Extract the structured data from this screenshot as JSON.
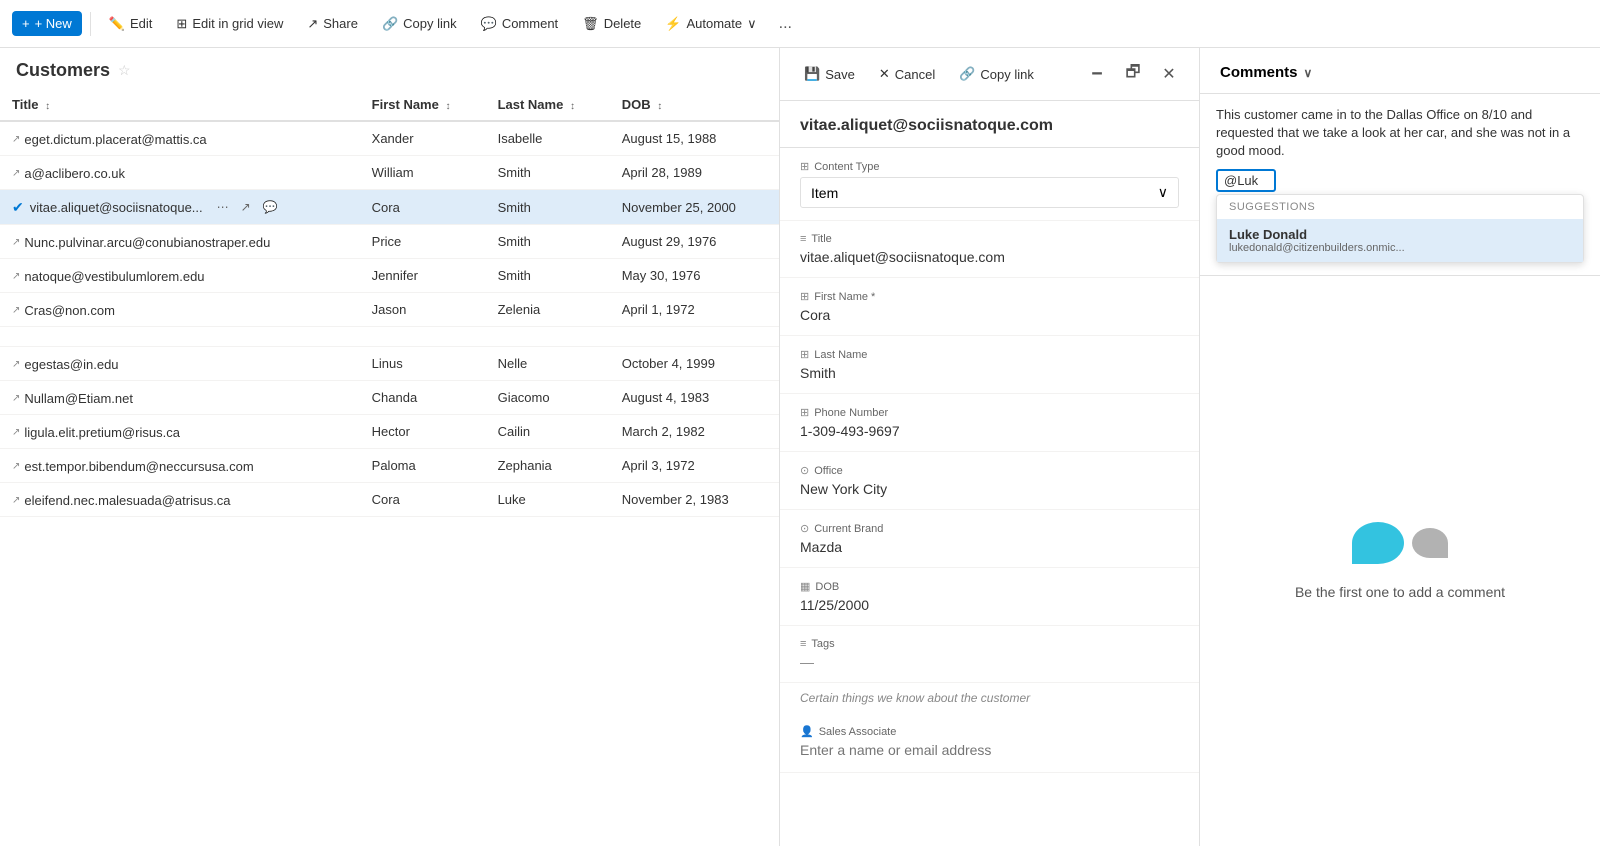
{
  "topbar": {
    "new_label": "+ New",
    "edit_label": "Edit",
    "edit_grid_label": "Edit in grid view",
    "share_label": "Share",
    "copy_link_label": "Copy link",
    "comment_label": "Comment",
    "delete_label": "Delete",
    "automate_label": "Automate",
    "overflow_label": "..."
  },
  "list": {
    "title": "Customers",
    "columns": [
      {
        "label": "Title",
        "sort": "↕"
      },
      {
        "label": "First Name",
        "sort": "↕"
      },
      {
        "label": "Last Name",
        "sort": "↕"
      },
      {
        "label": "DOB",
        "sort": "↕"
      }
    ],
    "rows": [
      {
        "title": "eget.dictum.placerat@mattis.ca",
        "first_name": "Xander",
        "last_name": "Isabelle",
        "dob": "August 15, 1988",
        "selected": false
      },
      {
        "title": "a@aclibero.co.uk",
        "first_name": "William",
        "last_name": "Smith",
        "dob": "April 28, 1989",
        "selected": false
      },
      {
        "title": "vitae.aliquet@sociisnatoque...",
        "first_name": "Cora",
        "last_name": "Smith",
        "dob": "November 25, 2000",
        "selected": true
      },
      {
        "title": "Nunc.pulvinar.arcu@conubianostraper.edu",
        "first_name": "Price",
        "last_name": "Smith",
        "dob": "August 29, 1976",
        "selected": false
      },
      {
        "title": "natoque@vestibulumlorem.edu",
        "first_name": "Jennifer",
        "last_name": "Smith",
        "dob": "May 30, 1976",
        "selected": false
      },
      {
        "title": "Cras@non.com",
        "first_name": "Jason",
        "last_name": "Zelenia",
        "dob": "April 1, 1972",
        "selected": false
      },
      {
        "title": "",
        "first_name": "",
        "last_name": "",
        "dob": "",
        "selected": false
      },
      {
        "title": "egestas@in.edu",
        "first_name": "Linus",
        "last_name": "Nelle",
        "dob": "October 4, 1999",
        "selected": false
      },
      {
        "title": "Nullam@Etiam.net",
        "first_name": "Chanda",
        "last_name": "Giacomo",
        "dob": "August 4, 1983",
        "selected": false
      },
      {
        "title": "ligula.elit.pretium@risus.ca",
        "first_name": "Hector",
        "last_name": "Cailin",
        "dob": "March 2, 1982",
        "selected": false
      },
      {
        "title": "est.tempor.bibendum@neccursusa.com",
        "first_name": "Paloma",
        "last_name": "Zephania",
        "dob": "April 3, 1972",
        "selected": false
      },
      {
        "title": "eleifend.nec.malesuada@atrisus.ca",
        "first_name": "Cora",
        "last_name": "Luke",
        "dob": "November 2, 1983",
        "selected": false
      }
    ]
  },
  "detail": {
    "header": "vitae.aliquet@sociisnatoque.com",
    "fields": [
      {
        "icon": "⊞",
        "label": "Content Type",
        "type": "select",
        "value": "Item"
      },
      {
        "icon": "≡",
        "label": "Title",
        "type": "text",
        "value": "vitae.aliquet@sociisnatoque.com"
      },
      {
        "icon": "⊞",
        "label": "First Name *",
        "type": "text",
        "value": "Cora"
      },
      {
        "icon": "⊞",
        "label": "Last Name",
        "type": "text",
        "value": "Smith"
      },
      {
        "icon": "⊞",
        "label": "Phone Number",
        "type": "text",
        "value": "1-309-493-9697"
      },
      {
        "icon": "⊙",
        "label": "Office",
        "type": "text",
        "value": "New York City"
      },
      {
        "icon": "⊙",
        "label": "Current Brand",
        "type": "text",
        "value": "Mazda"
      },
      {
        "icon": "▦",
        "label": "DOB",
        "type": "text",
        "value": "11/25/2000"
      },
      {
        "icon": "≡",
        "label": "Tags",
        "type": "text",
        "value": "—"
      },
      {
        "note": "Certain things we know about the customer"
      },
      {
        "icon": "👤",
        "label": "Sales Associate",
        "type": "input",
        "value": "",
        "placeholder": "Enter a name or email address"
      }
    ]
  },
  "dialog": {
    "save_label": "Save",
    "cancel_label": "Cancel",
    "copy_link_label": "Copy link",
    "win_minimize": "🗕",
    "win_maximize": "🗗",
    "win_close": "✕"
  },
  "comments": {
    "title": "Comments",
    "chevron": "∨",
    "comment_text": "This customer came in to the Dallas Office on 8/10 and requested that we take a look at her car, and she was not in a good mood.",
    "mention_value": "@Luk",
    "suggestions_label": "Suggestions",
    "suggestion": {
      "name": "Luke Donald",
      "email": "lukedonald@citizenbuilders.onmic..."
    },
    "empty_text": "Be the first one to add a comment"
  }
}
